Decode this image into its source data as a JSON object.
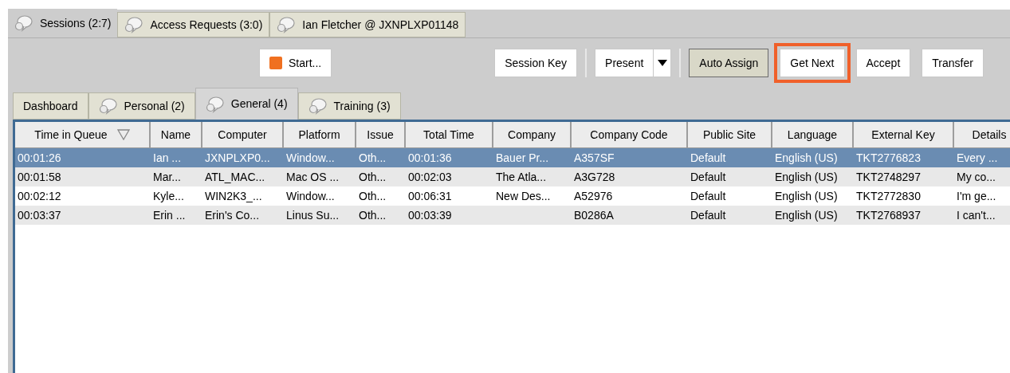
{
  "main_tabs": [
    {
      "label": "Sessions (2:7)",
      "selected": true
    },
    {
      "label": "Access Requests (3:0)",
      "selected": false
    },
    {
      "label": "Ian Fletcher @ JXNPLXP01148",
      "selected": false
    }
  ],
  "toolbar": {
    "buttons": [
      {
        "kind": "logo",
        "label": "Start...",
        "pressed": false,
        "highlighted": false
      },
      {
        "kind": "plain",
        "label": "Session Key",
        "pressed": false,
        "highlighted": false
      },
      {
        "kind": "dropdown",
        "label": "Present",
        "pressed": false,
        "highlighted": false
      },
      {
        "kind": "plain",
        "label": "Auto Assign",
        "pressed": true,
        "highlighted": false
      },
      {
        "kind": "plain",
        "label": "Get Next",
        "pressed": false,
        "highlighted": true
      },
      {
        "kind": "plain",
        "label": "Accept",
        "pressed": false,
        "highlighted": false
      },
      {
        "kind": "plain",
        "label": "Transfer",
        "pressed": false,
        "highlighted": false
      }
    ]
  },
  "queue_tabs": [
    {
      "label": "Dashboard",
      "icon": false,
      "selected": false
    },
    {
      "label": "Personal (2)",
      "icon": true,
      "selected": false
    },
    {
      "label": "General (4)",
      "icon": true,
      "selected": true
    },
    {
      "label": "Training (3)",
      "icon": true,
      "selected": false
    }
  ],
  "table": {
    "columns": [
      {
        "label": "Time in Queue",
        "sorted": true
      },
      {
        "label": "Name",
        "sorted": false
      },
      {
        "label": "Computer",
        "sorted": false
      },
      {
        "label": "Platform",
        "sorted": false
      },
      {
        "label": "Issue",
        "sorted": false
      },
      {
        "label": "Total Time",
        "sorted": false
      },
      {
        "label": "Company",
        "sorted": false
      },
      {
        "label": "Company Code",
        "sorted": false
      },
      {
        "label": "Public Site",
        "sorted": false
      },
      {
        "label": "Language",
        "sorted": false
      },
      {
        "label": "External Key",
        "sorted": false
      },
      {
        "label": "Details",
        "sorted": false
      }
    ],
    "rows": [
      {
        "selected": true,
        "cells": [
          "00:01:26",
          "Ian ...",
          "JXNPLXP0...",
          "Window...",
          "Oth...",
          "00:01:36",
          "Bauer Pr...",
          "A357SF",
          "Default",
          "English (US)",
          "TKT2776823",
          "Every ..."
        ]
      },
      {
        "selected": false,
        "cells": [
          "00:01:58",
          "Mar...",
          "ATL_MAC...",
          "Mac OS ...",
          "Oth...",
          "00:02:03",
          "The Atla...",
          "A3G728",
          "Default",
          "English (US)",
          "TKT2748297",
          "My co..."
        ]
      },
      {
        "selected": false,
        "cells": [
          "00:02:12",
          "Kyle...",
          "WIN2K3_...",
          "Window...",
          "Oth...",
          "00:06:31",
          "New Des...",
          "A52976",
          "Default",
          "English (US)",
          "TKT2772830",
          "I'm ge..."
        ]
      },
      {
        "selected": false,
        "cells": [
          "00:03:37",
          "Erin ...",
          "Erin's Co...",
          "Linus Su...",
          "Oth...",
          "00:03:39",
          "",
          "B0286A",
          "Default",
          "English (US)",
          "TKT2768937",
          "I can't..."
        ]
      }
    ]
  }
}
